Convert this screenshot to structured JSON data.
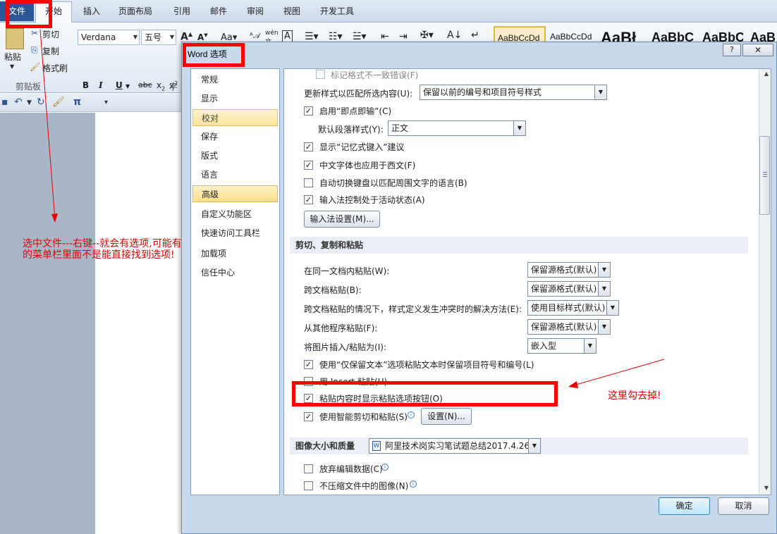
{
  "ribbon": {
    "tabs": [
      "文件",
      "开始",
      "插入",
      "页面布局",
      "引用",
      "邮件",
      "审阅",
      "视图",
      "开发工具"
    ],
    "clipboard": {
      "paste_label": "粘贴",
      "cut_label": "剪切",
      "copy_label": "复制",
      "format_painter_label": "格式刷",
      "group_label": "剪贴板"
    },
    "font_name": "Verdana",
    "font_size": "五号",
    "font_group_partial": "字",
    "styles": [
      "AaBbCcDd",
      "AaBbCcDd",
      "AaBł",
      "AaBbC",
      "AaBbC",
      "AaB"
    ]
  },
  "annotations": {
    "left_note": "选中文件---右键--就会有选项,可能有的菜单栏里面不是能直接找到选项!",
    "right_note": "这里勾去掉!"
  },
  "dialog": {
    "title": "Word 选项",
    "help_label": "?",
    "close_label": "✕",
    "nav": [
      "常规",
      "显示",
      "校对",
      "保存",
      "版式",
      "语言",
      "高级",
      "自定义功能区",
      "快速访问工具栏",
      "加载项",
      "信任中心"
    ],
    "nav_selected": "高级",
    "nav_hover": "校对",
    "top_partial": "标记格式不一致错误(F)",
    "update_style_label": "更新样式以匹配所选内容(U):",
    "update_style_value": "保留以前的编号和项目符号样式",
    "click_type_label": "启用“即点即输”(C)",
    "default_para_label": "默认段落样式(Y):",
    "default_para_value": "正文",
    "autocomplete_label": "显示“记忆式键入”建议",
    "chinese_font_label": "中文字体也应用于西文(F)",
    "auto_keyboard_label": "自动切换键盘以匹配周围文字的语言(B)",
    "ime_control_label": "输入法控制处于活动状态(A)",
    "ime_settings_button": "输入法设置(M)...",
    "section_cut_paste": "剪切、复制和粘贴",
    "paste_rows": [
      {
        "label": "在同一文档内粘贴(W):",
        "value": "保留源格式(默认)"
      },
      {
        "label": "跨文档粘贴(B):",
        "value": "保留源格式(默认)"
      },
      {
        "label": "跨文档粘贴的情况下，样式定义发生冲突时的解决方法(E):",
        "value": "使用目标样式(默认)"
      },
      {
        "label": "从其他程序粘贴(F):",
        "value": "保留源格式(默认)"
      },
      {
        "label": "将图片插入/粘贴为(I):",
        "value": "嵌入型"
      }
    ],
    "keep_text_only_label": "使用“仅保留文本”选项粘贴文本时保留项目符号和编号(L)",
    "insert_key_label": "用 Insert 粘贴(U)",
    "show_paste_options_label": "粘贴内容时显示粘贴选项按钮(O)",
    "smart_cut_label": "使用智能剪切和粘贴(S)",
    "settings_button": "设置(N)...",
    "section_image": "图像大小和质量",
    "image_doc_value": "阿里技术岗实习笔试题总结2017.4.26",
    "discard_edit_label": "放弃编辑数据(C)",
    "no_compress_label": "不压缩文件中的图像(N)",
    "ok_label": "确定",
    "cancel_label": "取消"
  },
  "colors": {
    "annotation_red": "#e60000",
    "file_tab_blue": "#2b5797",
    "selection_gold": "#fbdf8a"
  }
}
